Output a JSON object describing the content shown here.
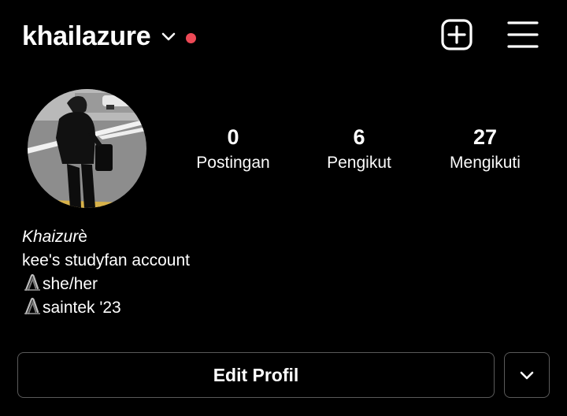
{
  "header": {
    "username": "khailazure",
    "icons": {
      "account_switch": "chevron-down-icon",
      "notification": "red-dot-indicator",
      "create": "plus-square-icon",
      "menu": "hamburger-menu-icon"
    },
    "colors": {
      "notification_dot": "#ed4956"
    }
  },
  "profile": {
    "avatar": "profile-photo",
    "stats": [
      {
        "value": "0",
        "label": "Postingan"
      },
      {
        "value": "6",
        "label": "Pengikut"
      },
      {
        "value": "27",
        "label": "Mengikuti"
      }
    ]
  },
  "bio": {
    "display_name_italic": "Khaizur",
    "display_name_rest": "è",
    "lines": [
      "kee's studyfan account",
      "she/her",
      "saintek '23"
    ],
    "line_icon": "paperclip-icon"
  },
  "actions": {
    "edit_profile": "Edit Profil",
    "more_icon": "chevron-down-icon"
  }
}
